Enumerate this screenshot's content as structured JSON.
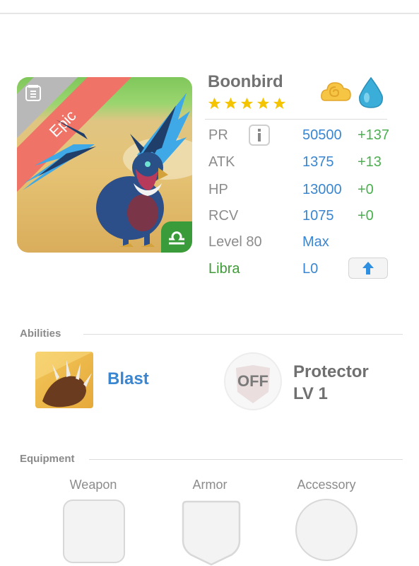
{
  "monster": {
    "name": "Boonbird",
    "rarity": "Epic",
    "star_count": 5,
    "elements": [
      "light-cloud-icon",
      "water-drop-icon"
    ]
  },
  "stats": {
    "pr": {
      "label": "PR",
      "value": "50500",
      "bonus": "+137"
    },
    "atk": {
      "label": "ATK",
      "value": "1375",
      "bonus": "+13"
    },
    "hp": {
      "label": "HP",
      "value": "13000",
      "bonus": "+0"
    },
    "rcv": {
      "label": "RCV",
      "value": "1075",
      "bonus": "+0"
    },
    "level": {
      "label": "Level 80",
      "value": "Max"
    },
    "constellation": {
      "label": "Libra",
      "value": "L0"
    }
  },
  "abilities": {
    "title": "Abilities",
    "active": {
      "name": "Blast"
    },
    "passive": {
      "badge": "OFF",
      "name_line1": "Protector",
      "name_line2": "LV 1"
    }
  },
  "equipment": {
    "title": "Equipment",
    "slots": [
      "Weapon",
      "Armor",
      "Accessory"
    ]
  },
  "colors": {
    "value_blue": "#3a86d0",
    "bonus_green": "#4caf50",
    "constellation_green": "#3f9b38",
    "epic_ribbon": "#ef7366"
  }
}
